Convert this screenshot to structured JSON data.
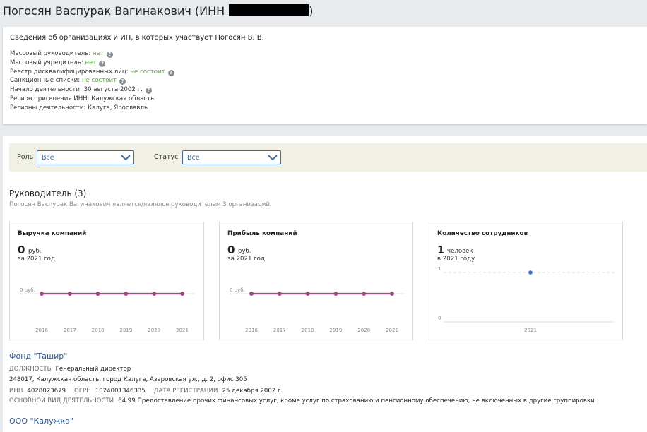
{
  "page": {
    "title": "Погосян Васпурак Вагинакович (ИНН",
    "title_end": ")"
  },
  "summary": {
    "heading": "Сведения об организациях и ИП, в которых участвует Погосян В. В.",
    "rows": [
      {
        "label": "Массовый руководитель:",
        "value": "нет",
        "green": true,
        "help": true
      },
      {
        "label": "Массовый учредитель:",
        "value": "нет",
        "green": true,
        "help": true
      },
      {
        "label": "Реестр дисквалифицированных лиц:",
        "value": "не состоит",
        "green": true,
        "help": true
      },
      {
        "label": "Санкционные списки:",
        "value": "не состоит",
        "green": true,
        "help": true
      },
      {
        "label": "Начало деятельности:",
        "value": "30 августа 2002 г.",
        "green": false,
        "help": true
      },
      {
        "label": "Регион присвоения ИНН:",
        "value": "Калужская область",
        "green": false,
        "help": false
      },
      {
        "label": "Регионы деятельности:",
        "value": "Калуга, Ярославль",
        "green": false,
        "help": false
      }
    ]
  },
  "filters": {
    "role_label": "Роль",
    "role_value": "Все",
    "status_label": "Статус",
    "status_value": "Все"
  },
  "section": {
    "title": "Руководитель (3)",
    "subtitle": "Погосян Васпурак Вагинакович является/являлся руководителем 3 организаций."
  },
  "chart_data": [
    {
      "type": "line",
      "title": "Выручка компаний",
      "value": "0",
      "unit": "руб.",
      "period": "за 2021 год",
      "x": [
        "2016",
        "2017",
        "2018",
        "2019",
        "2020",
        "2021"
      ],
      "values": [
        0,
        0,
        0,
        0,
        0,
        0
      ],
      "ytick": "0 руб.",
      "color": "#9c4a86"
    },
    {
      "type": "line",
      "title": "Прибыль компаний",
      "value": "0",
      "unit": "руб.",
      "period": "за 2021 год",
      "x": [
        "2016",
        "2017",
        "2018",
        "2019",
        "2020",
        "2021"
      ],
      "values": [
        0,
        0,
        0,
        0,
        0,
        0
      ],
      "ytick": "0 руб.",
      "color": "#9c4a86"
    },
    {
      "type": "scatter",
      "title": "Количество сотрудников",
      "value": "1",
      "unit": "человек",
      "period": "в 2021 году",
      "x": [
        "2021"
      ],
      "values": [
        1
      ],
      "yticks": [
        "1",
        "0"
      ],
      "ylim": [
        0,
        1
      ],
      "color": "#2f6fd6"
    }
  ],
  "organizations": [
    {
      "name": "Фонд \"Ташир\"",
      "position_label": "ДОЛЖНОСТЬ",
      "position": "Генеральный директор",
      "address": "248017, Калужская область, город Калуга, Азаровская ул., д. 2, офис 305",
      "inn_label": "ИНН",
      "inn": "4028023679",
      "ogrn_label": "ОГРН",
      "ogrn": "1024001346335",
      "reg_label": "ДАТА РЕГИСТРАЦИИ",
      "reg_date": "25 декабря 2002 г.",
      "activity_label": "ОСНОВНОЙ ВИД ДЕЯТЕЛЬНОСТИ",
      "activity": "64.99 Предоставление прочих финансовых услуг, кроме услуг по страхованию и пенсионному обеспечению, не включенных в другие группировки"
    },
    {
      "name": "ООО \"Калужка\""
    }
  ],
  "colors": {
    "link": "#2e5d9e",
    "green": "#4caf2c",
    "background": "#e8ebee"
  }
}
